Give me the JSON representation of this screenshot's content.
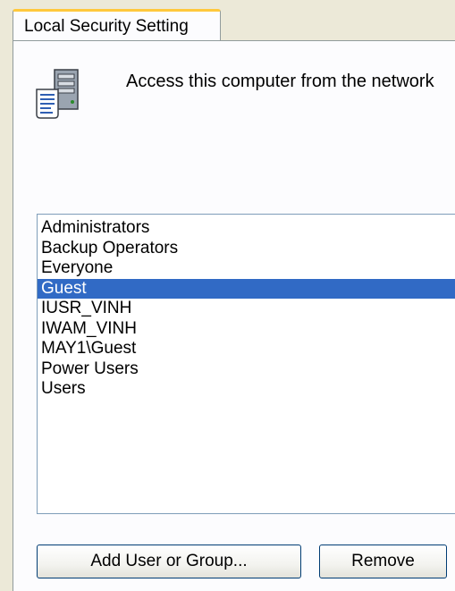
{
  "tab": {
    "label": "Local Security Setting"
  },
  "policy": {
    "icon": "server-document-icon",
    "title": "Access this computer from the network"
  },
  "principals": {
    "items": [
      {
        "label": "Administrators",
        "selected": false
      },
      {
        "label": "Backup Operators",
        "selected": false
      },
      {
        "label": "Everyone",
        "selected": false
      },
      {
        "label": "Guest",
        "selected": true
      },
      {
        "label": "IUSR_VINH",
        "selected": false
      },
      {
        "label": "IWAM_VINH",
        "selected": false
      },
      {
        "label": "MAY1\\Guest",
        "selected": false
      },
      {
        "label": "Power Users",
        "selected": false
      },
      {
        "label": "Users",
        "selected": false
      }
    ]
  },
  "buttons": {
    "add_label": "Add User or Group...",
    "remove_label": "Remove"
  },
  "colors": {
    "selection": "#316ac5",
    "tab_highlight": "#ffc83c",
    "dialog_background": "#ece9d8"
  }
}
